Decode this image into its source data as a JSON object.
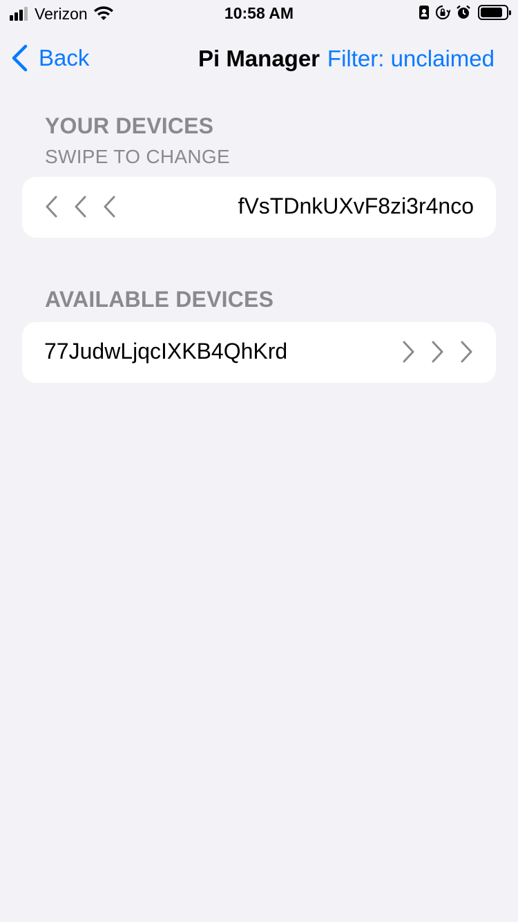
{
  "status_bar": {
    "carrier": "Verizon",
    "time": "10:58 AM",
    "battery_level": 0.85,
    "icons": [
      "signal-icon",
      "wifi-icon",
      "portrait-icon",
      "rotation-lock-icon",
      "alarm-icon",
      "battery-icon"
    ]
  },
  "nav": {
    "back_label": "Back",
    "title": "Pi Manager",
    "filter_label": "Filter: unclaimed"
  },
  "your_devices": {
    "header": "YOUR DEVICES",
    "subheader": "SWIPE TO CHANGE",
    "items": [
      {
        "id": "fVsTDnkUXvF8zi3r4nco"
      }
    ]
  },
  "available_devices": {
    "header": "AVAILABLE DEVICES",
    "items": [
      {
        "id": "77JudwLjqcIXKB4QhKrd"
      }
    ]
  },
  "colors": {
    "accent": "#0a7aff",
    "background": "#f2f2f7",
    "section_label": "#8a8a8e",
    "chevron": "#8a8a8e"
  }
}
